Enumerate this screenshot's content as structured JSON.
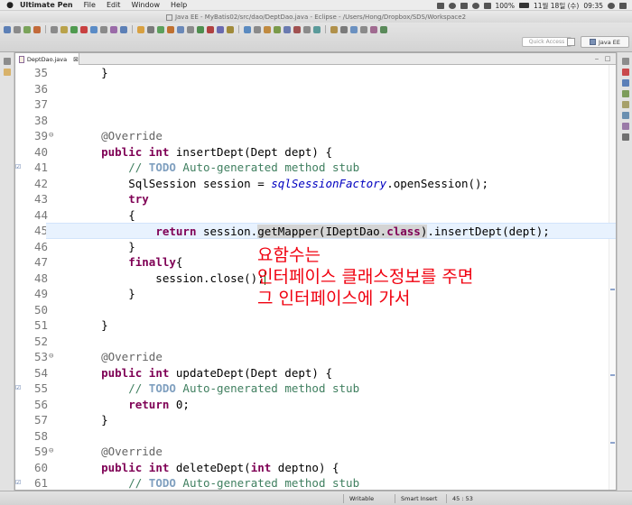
{
  "menubar": {
    "items": [
      "Ultimate Pen",
      "File",
      "Edit",
      "Window",
      "Help"
    ],
    "battery": "100%",
    "date": "11월 18일 (수)",
    "time": "09:35"
  },
  "window": {
    "title": "Java EE - MyBatis02/src/dao/DeptDao.java - Eclipse - /Users/Hong/Dropbox/SDS/Workspace2"
  },
  "toolbar": {
    "quick_access_placeholder": "Quick Access",
    "perspective": "Java EE"
  },
  "editor": {
    "tab_label": "DeptDao.java",
    "tab_close": "⊠",
    "lines": [
      {
        "n": "35",
        "tokens": [
          [
            "p",
            "    }"
          ]
        ]
      },
      {
        "n": "36",
        "tokens": []
      },
      {
        "n": "37",
        "tokens": []
      },
      {
        "n": "38",
        "tokens": []
      },
      {
        "n": "39",
        "fold": "⊖",
        "tokens": [
          [
            "p",
            "    "
          ],
          [
            "ann",
            "@Override"
          ]
        ]
      },
      {
        "n": "40",
        "tokens": [
          [
            "p",
            "    "
          ],
          [
            "kw",
            "public"
          ],
          [
            "p",
            " "
          ],
          [
            "kw",
            "int"
          ],
          [
            "p",
            " insertDept(Dept dept) {"
          ]
        ]
      },
      {
        "n": "41",
        "marker": "☑",
        "tokens": [
          [
            "p",
            "        "
          ],
          [
            "cm",
            "// "
          ],
          [
            "todo",
            "TODO"
          ],
          [
            "cm",
            " Auto-generated method stub"
          ]
        ]
      },
      {
        "n": "42",
        "tokens": [
          [
            "p",
            "        SqlSession session = "
          ],
          [
            "st",
            "sqlSessionFactory"
          ],
          [
            "p",
            ".openSession();"
          ]
        ]
      },
      {
        "n": "43",
        "tokens": [
          [
            "p",
            "        "
          ],
          [
            "kw",
            "try"
          ]
        ]
      },
      {
        "n": "44",
        "tokens": [
          [
            "p",
            "        {"
          ]
        ]
      },
      {
        "n": "45",
        "highlight": true,
        "tokens": [
          [
            "p",
            "            "
          ],
          [
            "kw",
            "return"
          ],
          [
            "p",
            " session."
          ],
          [
            "occ",
            "getMapper(IDeptDao."
          ],
          [
            "occkw",
            "class"
          ],
          [
            "occ",
            ")"
          ],
          [
            "p",
            ".insertDept(dept);"
          ]
        ]
      },
      {
        "n": "46",
        "tokens": [
          [
            "p",
            "        }"
          ]
        ]
      },
      {
        "n": "47",
        "tokens": [
          [
            "p",
            "        "
          ],
          [
            "kw",
            "finally"
          ],
          [
            "p",
            "{"
          ]
        ]
      },
      {
        "n": "48",
        "tokens": [
          [
            "p",
            "            session.close();"
          ]
        ]
      },
      {
        "n": "49",
        "tokens": [
          [
            "p",
            "        }"
          ]
        ]
      },
      {
        "n": "50",
        "tokens": []
      },
      {
        "n": "51",
        "tokens": [
          [
            "p",
            "    }"
          ]
        ]
      },
      {
        "n": "52",
        "tokens": []
      },
      {
        "n": "53",
        "fold": "⊖",
        "tokens": [
          [
            "p",
            "    "
          ],
          [
            "ann",
            "@Override"
          ]
        ]
      },
      {
        "n": "54",
        "tokens": [
          [
            "p",
            "    "
          ],
          [
            "kw",
            "public"
          ],
          [
            "p",
            " "
          ],
          [
            "kw",
            "int"
          ],
          [
            "p",
            " updateDept(Dept dept) {"
          ]
        ]
      },
      {
        "n": "55",
        "marker": "☑",
        "tokens": [
          [
            "p",
            "        "
          ],
          [
            "cm",
            "// "
          ],
          [
            "todo",
            "TODO"
          ],
          [
            "cm",
            " Auto-generated method stub"
          ]
        ]
      },
      {
        "n": "56",
        "tokens": [
          [
            "p",
            "        "
          ],
          [
            "kw",
            "return"
          ],
          [
            "p",
            " 0;"
          ]
        ]
      },
      {
        "n": "57",
        "tokens": [
          [
            "p",
            "    }"
          ]
        ]
      },
      {
        "n": "58",
        "tokens": []
      },
      {
        "n": "59",
        "fold": "⊖",
        "tokens": [
          [
            "p",
            "    "
          ],
          [
            "ann",
            "@Override"
          ]
        ]
      },
      {
        "n": "60",
        "tokens": [
          [
            "p",
            "    "
          ],
          [
            "kw",
            "public"
          ],
          [
            "p",
            " "
          ],
          [
            "kw",
            "int"
          ],
          [
            "p",
            " deleteDept("
          ],
          [
            "kw",
            "int"
          ],
          [
            "p",
            " deptno) {"
          ]
        ]
      },
      {
        "n": "61",
        "marker": "☑",
        "tokens": [
          [
            "p",
            "        "
          ],
          [
            "cm",
            "// "
          ],
          [
            "todo",
            "TODO"
          ],
          [
            "cm",
            " Auto-generated method stub"
          ]
        ]
      }
    ]
  },
  "annotation": {
    "line1": "요함수는",
    "line2": "인터페이스 클래스정보를 주면",
    "line3": "그 인터페이스에 가서"
  },
  "status": {
    "writable": "Writable",
    "insert_mode": "Smart Insert",
    "position": "45 : 53"
  },
  "colors": {
    "keyword": "#7f0055",
    "comment": "#3f7f5f",
    "annotation_text": "#f0000f",
    "highlight_line": "#e8f2fe"
  }
}
